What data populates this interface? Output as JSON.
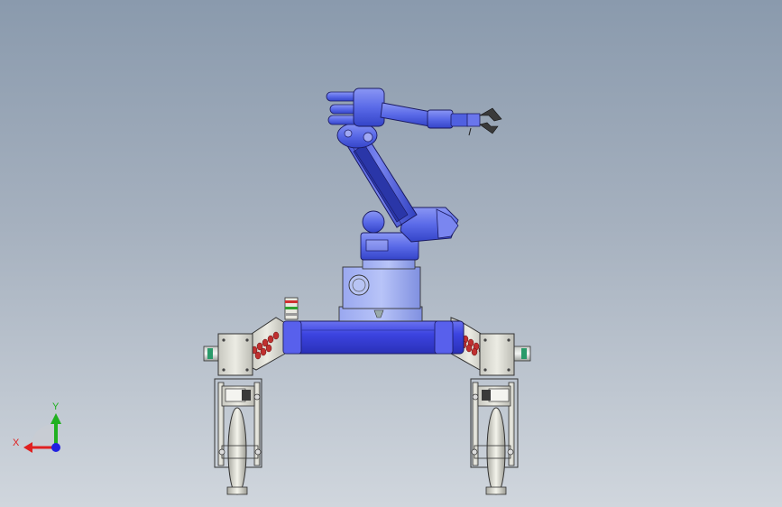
{
  "viewport": {
    "background_top": "#8a9aad",
    "background_bottom": "#d0d6dd"
  },
  "model": {
    "arm_color": "#5a6ae8",
    "base_color": "#4040d8",
    "frame_color": "#d8d8d0",
    "spring_color": "#c03030",
    "wheel_color": "#f0f0e8"
  },
  "triad": {
    "x_label": "X",
    "y_label": "Y",
    "x_color": "#e02020",
    "y_color": "#20b020",
    "z_color": "#2020e0"
  }
}
